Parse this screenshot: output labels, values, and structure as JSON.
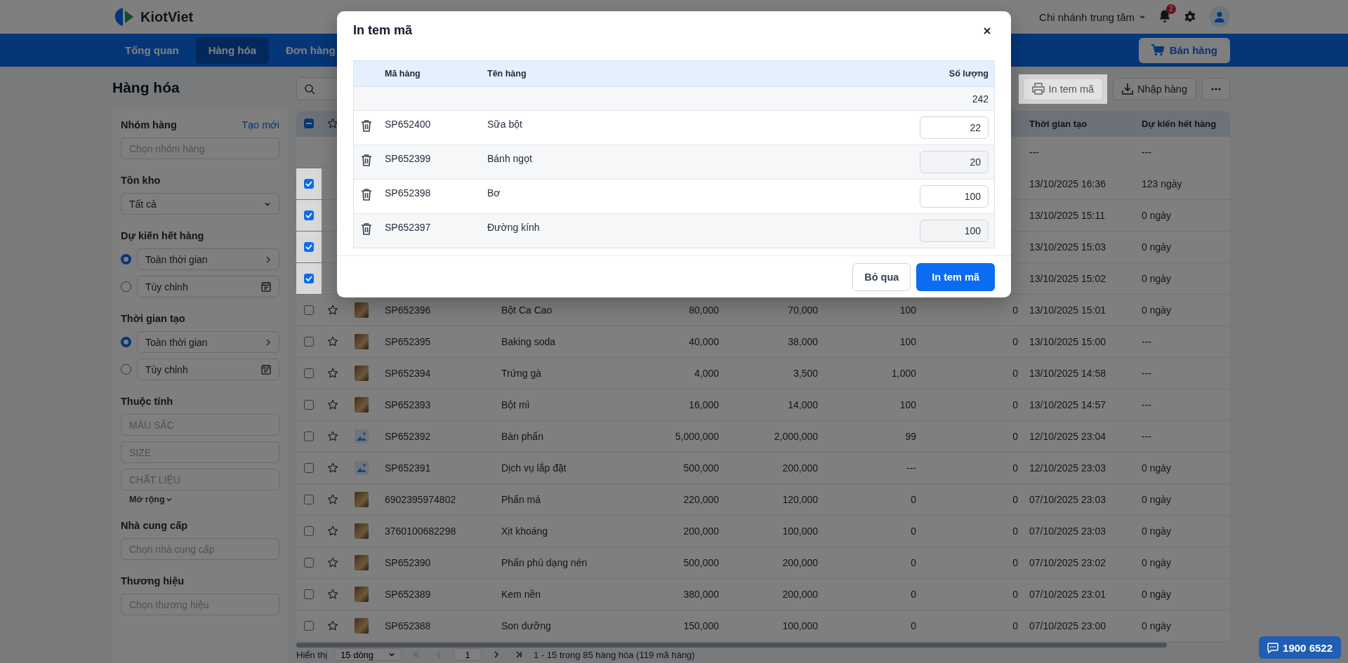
{
  "header": {
    "logo": "KiotViet",
    "branch": "Chi nhánh trung tâm",
    "notification_count": "2"
  },
  "nav": {
    "tabs": [
      {
        "label": "Tổng quan",
        "selected": false
      },
      {
        "label": "Hàng hóa",
        "selected": true
      },
      {
        "label": "Đơn hàng",
        "selected": false
      }
    ],
    "sell_button": "Bán hàng"
  },
  "page_title": "Hàng hóa",
  "filters": [
    {
      "kind": "select",
      "title": "Nhóm hàng",
      "action": "Tạo mới",
      "placeholder": "Chọn nhóm hàng"
    },
    {
      "kind": "dropdown",
      "title": "Tồn kho",
      "value": "Tất cả"
    },
    {
      "kind": "radio",
      "title": "Dự kiến hết hàng",
      "options": [
        {
          "kind": "preset",
          "label": "Toàn thời gian",
          "selected": true
        },
        {
          "kind": "custom",
          "label": "Tùy chỉnh",
          "selected": false
        }
      ]
    },
    {
      "kind": "radio",
      "title": "Thời gian tạo",
      "options": [
        {
          "kind": "preset",
          "label": "Toàn thời gian",
          "selected": true
        },
        {
          "kind": "custom",
          "label": "Tùy chỉnh",
          "selected": false
        }
      ]
    },
    {
      "kind": "attributes",
      "title": "Thuộc tính",
      "placeholders": [
        "MÀU SẮC",
        "SIZE",
        "CHẤT LIỆU"
      ],
      "more": "Mở rộng"
    },
    {
      "kind": "select",
      "title": "Nhà cung cấp",
      "placeholder": "Chọn nhà cung cấp"
    },
    {
      "kind": "select",
      "title": "Thương hiệu",
      "placeholder": "Chọn thương hiệu"
    }
  ],
  "toolbar": {
    "print_button": "In tem mã",
    "import_button": "Nhập hàng"
  },
  "table": {
    "select_all": {
      "checked": true,
      "partial": true
    },
    "columns": [
      "Thời gian tạo",
      "Dự kiến hết hàng"
    ],
    "summary": {
      "created": "---",
      "expected": "---"
    },
    "rows": [
      {
        "checked": true,
        "created": "13/10/2025 16:36",
        "expected": "123 ngày"
      },
      {
        "checked": true,
        "created": "13/10/2025 15:11",
        "expected": "0 ngày"
      },
      {
        "checked": true,
        "created": "13/10/2025 15:03",
        "expected": "0 ngày"
      },
      {
        "checked": true,
        "created": "13/10/2025 15:02",
        "expected": "0 ngày"
      },
      {
        "checked": false,
        "kind": "photo",
        "code": "SP652396",
        "name": "Bột Ca Cao",
        "column_5": "80,000",
        "column_6": "70,000",
        "column_7": "100",
        "column_8": "0",
        "created": "13/10/2025 15:01",
        "expected": "0 ngày"
      },
      {
        "checked": false,
        "kind": "photo",
        "code": "SP652395",
        "name": "Baking soda",
        "column_5": "40,000",
        "column_6": "38,000",
        "column_7": "100",
        "column_8": "0",
        "created": "13/10/2025 15:00",
        "expected": "---"
      },
      {
        "checked": false,
        "kind": "photo",
        "code": "SP652394",
        "name": "Trứng gà",
        "column_5": "4,000",
        "column_6": "3,500",
        "column_7": "1,000",
        "column_8": "0",
        "created": "13/10/2025 14:58",
        "expected": "---"
      },
      {
        "checked": false,
        "kind": "photo",
        "code": "SP652393",
        "name": "Bột mì",
        "column_5": "16,000",
        "column_6": "14,000",
        "column_7": "100",
        "column_8": "0",
        "created": "13/10/2025 14:57",
        "expected": "---"
      },
      {
        "checked": false,
        "kind": "placeholder",
        "code": "SP652392",
        "name": "Bàn phấn",
        "column_5": "5,000,000",
        "column_6": "2,000,000",
        "column_7": "99",
        "column_8": "0",
        "created": "12/10/2025 23:04",
        "expected": "---"
      },
      {
        "checked": false,
        "kind": "placeholder",
        "code": "SP652391",
        "name": "Dịch vụ lắp đặt",
        "column_5": "500,000",
        "column_6": "200,000",
        "column_7": "---",
        "column_8": "0",
        "created": "12/10/2025 23:03",
        "expected": "0 ngày"
      },
      {
        "checked": false,
        "kind": "photo",
        "code": "6902395974802",
        "name": "Phấn má",
        "column_5": "220,000",
        "column_6": "120,000",
        "column_7": "0",
        "column_8": "0",
        "created": "07/10/2025 23:03",
        "expected": "0 ngày"
      },
      {
        "checked": false,
        "kind": "photo",
        "code": "3760100682298",
        "name": "Xịt khoáng",
        "column_5": "200,000",
        "column_6": "100,000",
        "column_7": "0",
        "column_8": "0",
        "created": "07/10/2025 23:03",
        "expected": "0 ngày"
      },
      {
        "checked": false,
        "kind": "photo",
        "code": "SP652390",
        "name": "Phấn phủ dạng nén",
        "column_5": "500,000",
        "column_6": "200,000",
        "column_7": "0",
        "column_8": "0",
        "created": "07/10/2025 23:02",
        "expected": "0 ngày"
      },
      {
        "checked": false,
        "kind": "photo",
        "code": "SP652389",
        "name": "Kem nền",
        "column_5": "380,000",
        "column_6": "200,000",
        "column_7": "0",
        "column_8": "0",
        "created": "07/10/2025 23:01",
        "expected": "0 ngày"
      },
      {
        "checked": false,
        "kind": "photo",
        "code": "SP652388",
        "name": "Son dưỡng",
        "column_5": "150,000",
        "column_6": "100,000",
        "column_7": "0",
        "column_8": "0",
        "created": "07/10/2025 23:00",
        "expected": "0 ngày"
      }
    ]
  },
  "pagination": {
    "label": "Hiển thị",
    "page_size": "15 dòng",
    "page": "1",
    "summary": "1 - 15 trong 85 hàng hóa (119 mã hàng)"
  },
  "chat_button": "1900 6522",
  "modal": {
    "title": "In tem mã",
    "columns": [
      "Mã hàng",
      "Tên hàng",
      "Số lượng"
    ],
    "total": "242",
    "items": [
      {
        "code": "SP652400",
        "name": "Sữa bột",
        "quantity": "22"
      },
      {
        "code": "SP652399",
        "name": "Bánh ngọt",
        "quantity": "20"
      },
      {
        "code": "SP652398",
        "name": "Bơ",
        "quantity": "100"
      },
      {
        "code": "SP652397",
        "name": "Đường kính",
        "quantity": "100"
      }
    ],
    "cancel_button": "Bỏ qua",
    "confirm_button": "In tem mã"
  }
}
